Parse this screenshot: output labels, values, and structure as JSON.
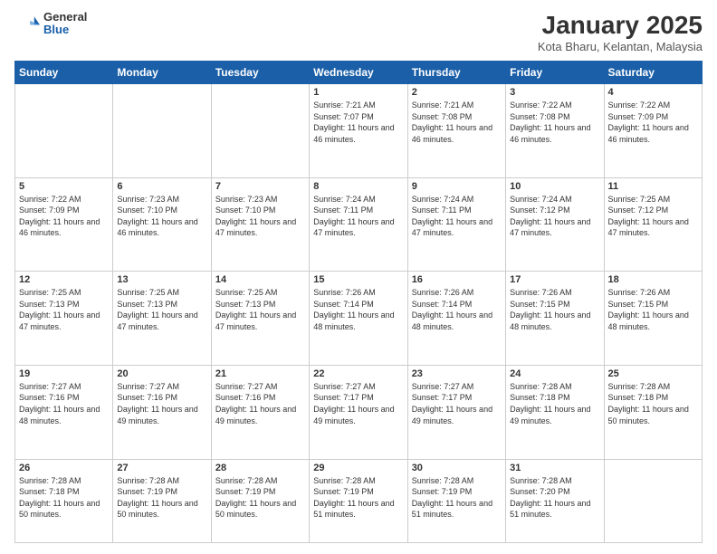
{
  "header": {
    "logo_general": "General",
    "logo_blue": "Blue",
    "month_title": "January 2025",
    "location": "Kota Bharu, Kelantan, Malaysia"
  },
  "weekdays": [
    "Sunday",
    "Monday",
    "Tuesday",
    "Wednesday",
    "Thursday",
    "Friday",
    "Saturday"
  ],
  "weeks": [
    [
      {
        "day": "",
        "empty": true
      },
      {
        "day": "",
        "empty": true
      },
      {
        "day": "",
        "empty": true
      },
      {
        "day": "1",
        "sunrise": "7:21 AM",
        "sunset": "7:07 PM",
        "daylight": "11 hours and 46 minutes."
      },
      {
        "day": "2",
        "sunrise": "7:21 AM",
        "sunset": "7:08 PM",
        "daylight": "11 hours and 46 minutes."
      },
      {
        "day": "3",
        "sunrise": "7:22 AM",
        "sunset": "7:08 PM",
        "daylight": "11 hours and 46 minutes."
      },
      {
        "day": "4",
        "sunrise": "7:22 AM",
        "sunset": "7:09 PM",
        "daylight": "11 hours and 46 minutes."
      }
    ],
    [
      {
        "day": "5",
        "sunrise": "7:22 AM",
        "sunset": "7:09 PM",
        "daylight": "11 hours and 46 minutes."
      },
      {
        "day": "6",
        "sunrise": "7:23 AM",
        "sunset": "7:10 PM",
        "daylight": "11 hours and 46 minutes."
      },
      {
        "day": "7",
        "sunrise": "7:23 AM",
        "sunset": "7:10 PM",
        "daylight": "11 hours and 47 minutes."
      },
      {
        "day": "8",
        "sunrise": "7:24 AM",
        "sunset": "7:11 PM",
        "daylight": "11 hours and 47 minutes."
      },
      {
        "day": "9",
        "sunrise": "7:24 AM",
        "sunset": "7:11 PM",
        "daylight": "11 hours and 47 minutes."
      },
      {
        "day": "10",
        "sunrise": "7:24 AM",
        "sunset": "7:12 PM",
        "daylight": "11 hours and 47 minutes."
      },
      {
        "day": "11",
        "sunrise": "7:25 AM",
        "sunset": "7:12 PM",
        "daylight": "11 hours and 47 minutes."
      }
    ],
    [
      {
        "day": "12",
        "sunrise": "7:25 AM",
        "sunset": "7:13 PM",
        "daylight": "11 hours and 47 minutes."
      },
      {
        "day": "13",
        "sunrise": "7:25 AM",
        "sunset": "7:13 PM",
        "daylight": "11 hours and 47 minutes."
      },
      {
        "day": "14",
        "sunrise": "7:25 AM",
        "sunset": "7:13 PM",
        "daylight": "11 hours and 47 minutes."
      },
      {
        "day": "15",
        "sunrise": "7:26 AM",
        "sunset": "7:14 PM",
        "daylight": "11 hours and 48 minutes."
      },
      {
        "day": "16",
        "sunrise": "7:26 AM",
        "sunset": "7:14 PM",
        "daylight": "11 hours and 48 minutes."
      },
      {
        "day": "17",
        "sunrise": "7:26 AM",
        "sunset": "7:15 PM",
        "daylight": "11 hours and 48 minutes."
      },
      {
        "day": "18",
        "sunrise": "7:26 AM",
        "sunset": "7:15 PM",
        "daylight": "11 hours and 48 minutes."
      }
    ],
    [
      {
        "day": "19",
        "sunrise": "7:27 AM",
        "sunset": "7:16 PM",
        "daylight": "11 hours and 48 minutes."
      },
      {
        "day": "20",
        "sunrise": "7:27 AM",
        "sunset": "7:16 PM",
        "daylight": "11 hours and 49 minutes."
      },
      {
        "day": "21",
        "sunrise": "7:27 AM",
        "sunset": "7:16 PM",
        "daylight": "11 hours and 49 minutes."
      },
      {
        "day": "22",
        "sunrise": "7:27 AM",
        "sunset": "7:17 PM",
        "daylight": "11 hours and 49 minutes."
      },
      {
        "day": "23",
        "sunrise": "7:27 AM",
        "sunset": "7:17 PM",
        "daylight": "11 hours and 49 minutes."
      },
      {
        "day": "24",
        "sunrise": "7:28 AM",
        "sunset": "7:18 PM",
        "daylight": "11 hours and 49 minutes."
      },
      {
        "day": "25",
        "sunrise": "7:28 AM",
        "sunset": "7:18 PM",
        "daylight": "11 hours and 50 minutes."
      }
    ],
    [
      {
        "day": "26",
        "sunrise": "7:28 AM",
        "sunset": "7:18 PM",
        "daylight": "11 hours and 50 minutes."
      },
      {
        "day": "27",
        "sunrise": "7:28 AM",
        "sunset": "7:19 PM",
        "daylight": "11 hours and 50 minutes."
      },
      {
        "day": "28",
        "sunrise": "7:28 AM",
        "sunset": "7:19 PM",
        "daylight": "11 hours and 50 minutes."
      },
      {
        "day": "29",
        "sunrise": "7:28 AM",
        "sunset": "7:19 PM",
        "daylight": "11 hours and 51 minutes."
      },
      {
        "day": "30",
        "sunrise": "7:28 AM",
        "sunset": "7:19 PM",
        "daylight": "11 hours and 51 minutes."
      },
      {
        "day": "31",
        "sunrise": "7:28 AM",
        "sunset": "7:20 PM",
        "daylight": "11 hours and 51 minutes."
      },
      {
        "day": "",
        "empty": true
      }
    ]
  ],
  "labels": {
    "sunrise": "Sunrise:",
    "sunset": "Sunset:",
    "daylight": "Daylight:"
  }
}
